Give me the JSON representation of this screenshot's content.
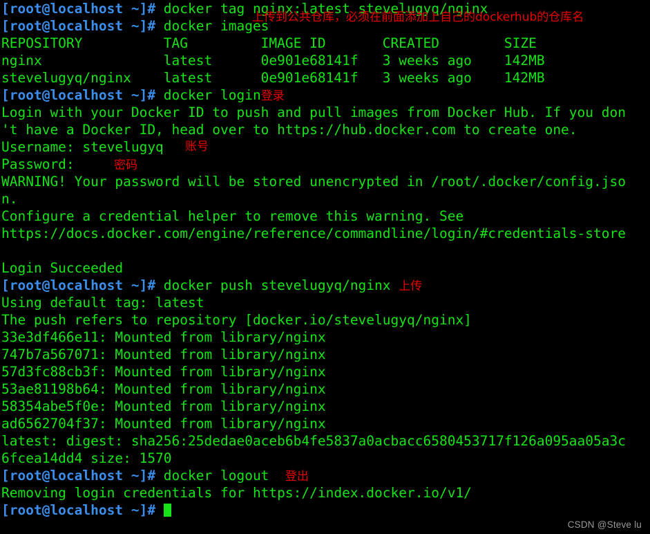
{
  "terminal": {
    "prompt": "[root@localhost ~]#",
    "cursor": "block-cursor",
    "colors": {
      "background": "#000000",
      "prompt_blue": "#3b8eea",
      "output_green": "#18e318",
      "annotation_red": "#e80000",
      "watermark_gray": "#9a9a9a"
    },
    "lines": {
      "l01_cmd": " docker tag nginx:latest stevelugyq/nginx",
      "l02_cmd": " docker images",
      "l02_anno": "上传到公共仓库，必须在前面添加上自己的dockerhub的仓库名",
      "l03_header": "REPOSITORY          TAG         IMAGE ID       CREATED        SIZE",
      "l04_row1": "nginx               latest      0e901e68141f   3 weeks ago    142MB",
      "l05_row2": "stevelugyq/nginx    latest      0e901e68141f   3 weeks ago    142MB",
      "l06_cmd": " docker login",
      "l06_anno": "登录",
      "l07_out": "Login with your Docker ID to push and pull images from Docker Hub. If you don",
      "l08_out": "'t have a Docker ID, head over to https://hub.docker.com to create one.",
      "l09_out": "Username: stevelugyq",
      "l09_anno": "账号",
      "l10_out": "Password:",
      "l10_anno": "密码",
      "l11_out": "WARNING! Your password will be stored unencrypted in /root/.docker/config.jso",
      "l12_out": "n.",
      "l13_out": "Configure a credential helper to remove this warning. See",
      "l14_out": "https://docs.docker.com/engine/reference/commandline/login/#credentials-store",
      "l15_blank": "",
      "l16_out": "Login Succeeded",
      "l17_cmd": " docker push stevelugyq/nginx ",
      "l17_anno": "上传",
      "l18_out": "Using default tag: latest",
      "l19_out": "The push refers to repository [docker.io/stevelugyq/nginx]",
      "l20_out": "33e3df466e11: Mounted from library/nginx",
      "l21_out": "747b7a567071: Mounted from library/nginx",
      "l22_out": "57d3fc88cb3f: Mounted from library/nginx",
      "l23_out": "53ae81198b64: Mounted from library/nginx",
      "l24_out": "58354abe5f0e: Mounted from library/nginx",
      "l25_out": "ad6562704f37: Mounted from library/nginx",
      "l26_out": "latest: digest: sha256:25dedae0aceb6b4fe5837a0acbacc6580453717f126a095aa05a3c",
      "l27_out": "6fcea14dd4 size: 1570",
      "l28_cmd": " docker logout  ",
      "l28_anno": "登出",
      "l29_out": "Removing login credentials for https://index.docker.io/v1/",
      "l30_cmd": " "
    },
    "watermark": "CSDN @Steve lu"
  }
}
